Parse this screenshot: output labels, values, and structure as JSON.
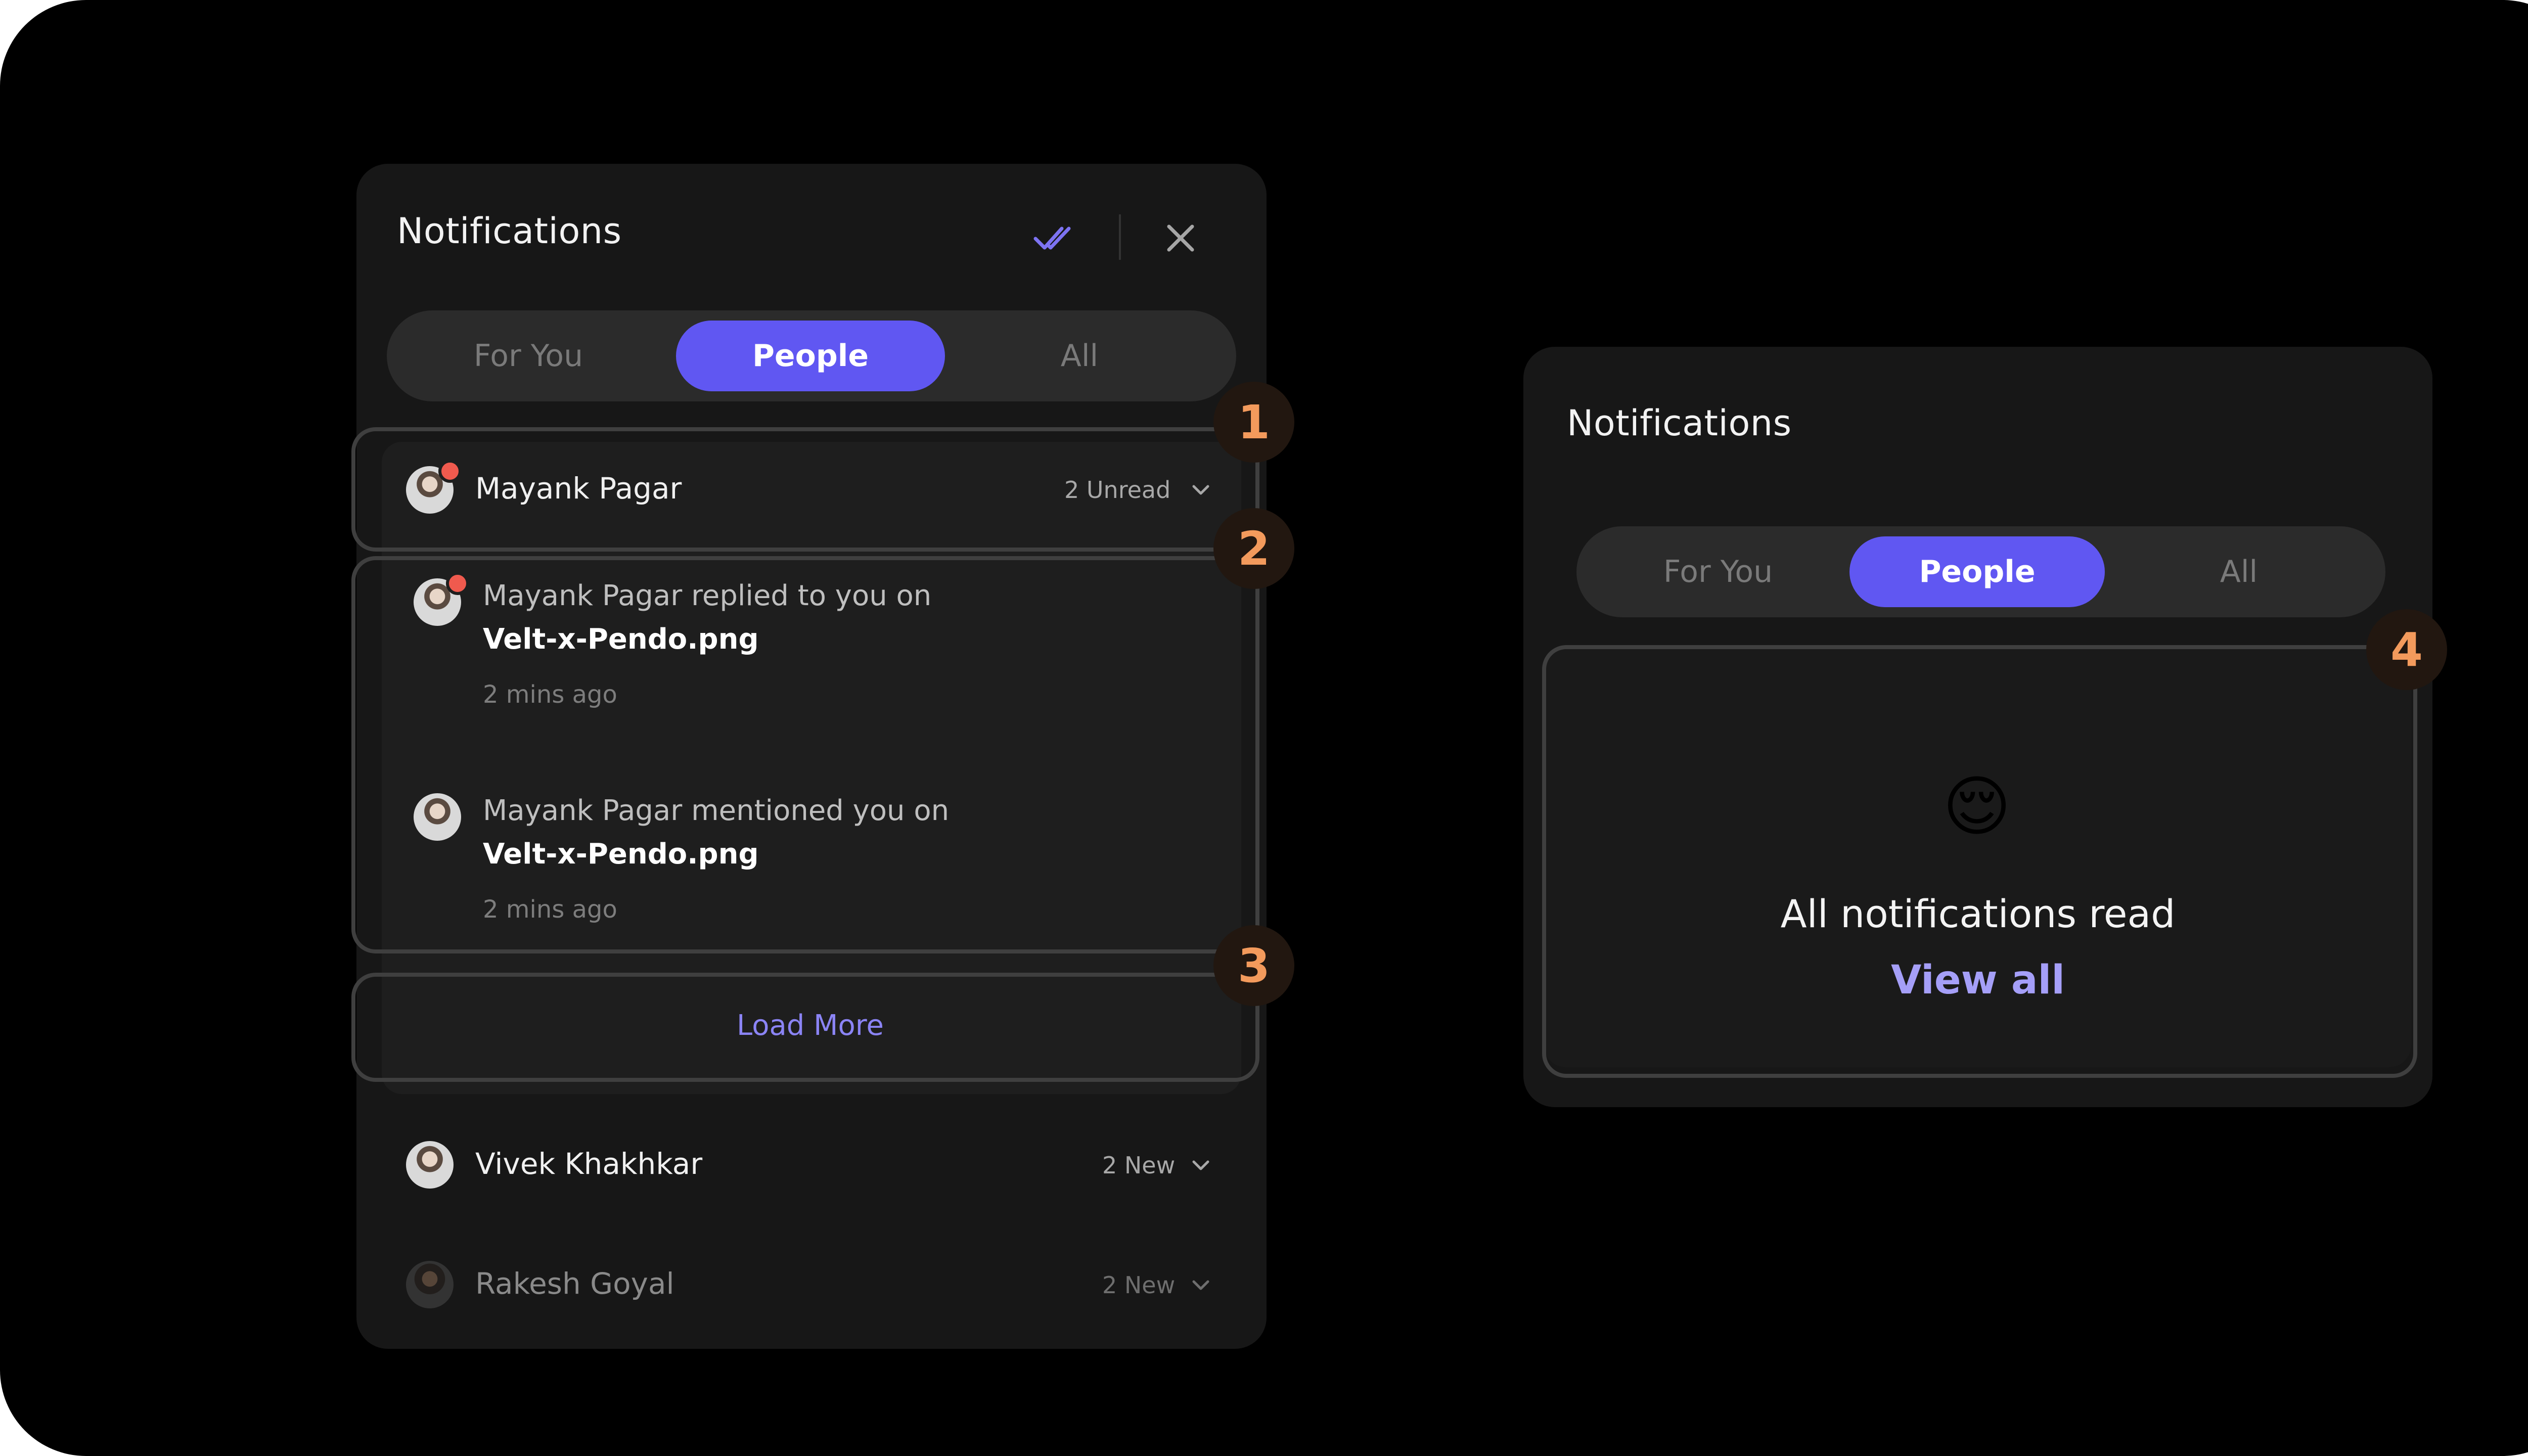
{
  "left_panel": {
    "title": "Notifications",
    "tabs": [
      {
        "label": "For You",
        "active": false
      },
      {
        "label": "People",
        "active": true
      },
      {
        "label": "All",
        "active": false
      }
    ],
    "groups": [
      {
        "name": "Mayank Pagar",
        "status": "2 Unread",
        "unread_dot": true,
        "expanded": true
      },
      {
        "name": "Vivek Khakhkar",
        "status": "2 New",
        "unread_dot": false
      },
      {
        "name": "Rakesh Goyal",
        "status": "2 New",
        "unread_dot": false
      }
    ],
    "notifications": [
      {
        "text": "Mayank Pagar replied to you on",
        "file": "Velt-x-Pendo.png",
        "time": "2 mins ago",
        "unread_dot": true
      },
      {
        "text": "Mayank Pagar mentioned you on",
        "file": "Velt-x-Pendo.png",
        "time": "2 mins ago",
        "unread_dot": false
      }
    ],
    "load_more_label": "Load More"
  },
  "right_panel": {
    "title": "Notifications",
    "tabs": [
      {
        "label": "For You",
        "active": false
      },
      {
        "label": "People",
        "active": true
      },
      {
        "label": "All",
        "active": false
      }
    ],
    "empty_state": {
      "emoji": "😌",
      "message": "All notifications read",
      "link_label": "View all"
    }
  },
  "annotations": [
    "1",
    "2",
    "3",
    "4"
  ],
  "colors": {
    "background": "#000000",
    "panel": "#171717",
    "accent": "#6057f2",
    "link": "#a59ff8",
    "badge_text": "#f39a5c",
    "unread_dot": "#f05a4e"
  },
  "icons": {
    "mark_all_read": "double-check-icon",
    "close": "close-icon",
    "expand": "chevron-down-icon"
  }
}
